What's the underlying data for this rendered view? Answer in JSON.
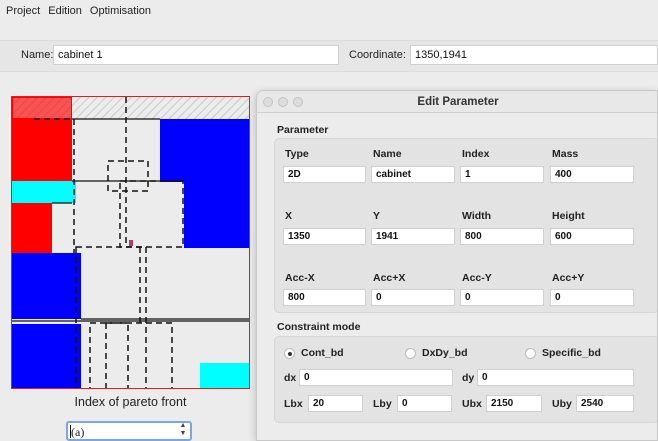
{
  "menu": {
    "items": [
      "Project",
      "Edition",
      "Optimisation"
    ]
  },
  "top": {
    "name_label": "Name:",
    "name_value": "cabinet 1",
    "coord_label": "Coordinate:",
    "coord_value": "1350,1941"
  },
  "plot": {
    "caption": "Index of pareto front",
    "spin_value": "(a)",
    "colors": {
      "border": "#e31b1b",
      "red": "#ff0000",
      "blue": "#0000ff",
      "cyan": "#00ffff",
      "hatch": "#c9c9c9"
    }
  },
  "dialog": {
    "title": "Edit Parameter",
    "parameter_title": "Parameter",
    "headers_row1": [
      "Type",
      "Name",
      "Index",
      "Mass"
    ],
    "values_row1": [
      "2D",
      "cabinet",
      "1",
      "400"
    ],
    "headers_row2": [
      "X",
      "Y",
      "Width",
      "Height"
    ],
    "values_row2": [
      "1350",
      "1941",
      "800",
      "600"
    ],
    "headers_row3": [
      "Acc-X",
      "Acc+X",
      "Acc-Y",
      "Acc+Y"
    ],
    "values_row3": [
      "800",
      "0",
      "0",
      "0"
    ],
    "constraint_title": "Constraint mode",
    "radios": [
      "Cont_bd",
      "DxDy_bd",
      "Specific_bd"
    ],
    "dx_label": "dx",
    "dx_value": "0",
    "dy_label": "dy",
    "dy_value": "0",
    "bounds": [
      {
        "label": "Lbx",
        "value": "20"
      },
      {
        "label": "Lby",
        "value": "0"
      },
      {
        "label": "Ubx",
        "value": "2150"
      },
      {
        "label": "Uby",
        "value": "2540"
      }
    ]
  }
}
